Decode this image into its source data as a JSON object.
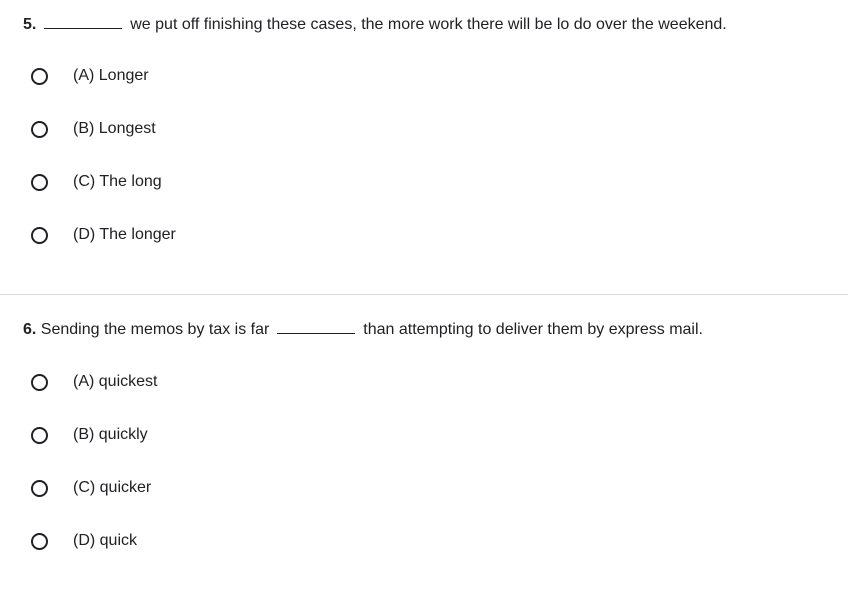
{
  "questions": [
    {
      "number": "5.",
      "text_before": "",
      "text_after": "we put off finishing these cases, the more work there will be lo do over the weekend.",
      "options": [
        "(A) Longer",
        "(B) Longest",
        "(C) The long",
        "(D) The longer"
      ]
    },
    {
      "number": "6.",
      "text_before": "Sending the memos by tax is far",
      "text_after": "than attempting to deliver them by express mail.",
      "options": [
        "(A) quickest",
        "(B) quickly",
        "(C) quicker",
        "(D) quick"
      ]
    }
  ]
}
